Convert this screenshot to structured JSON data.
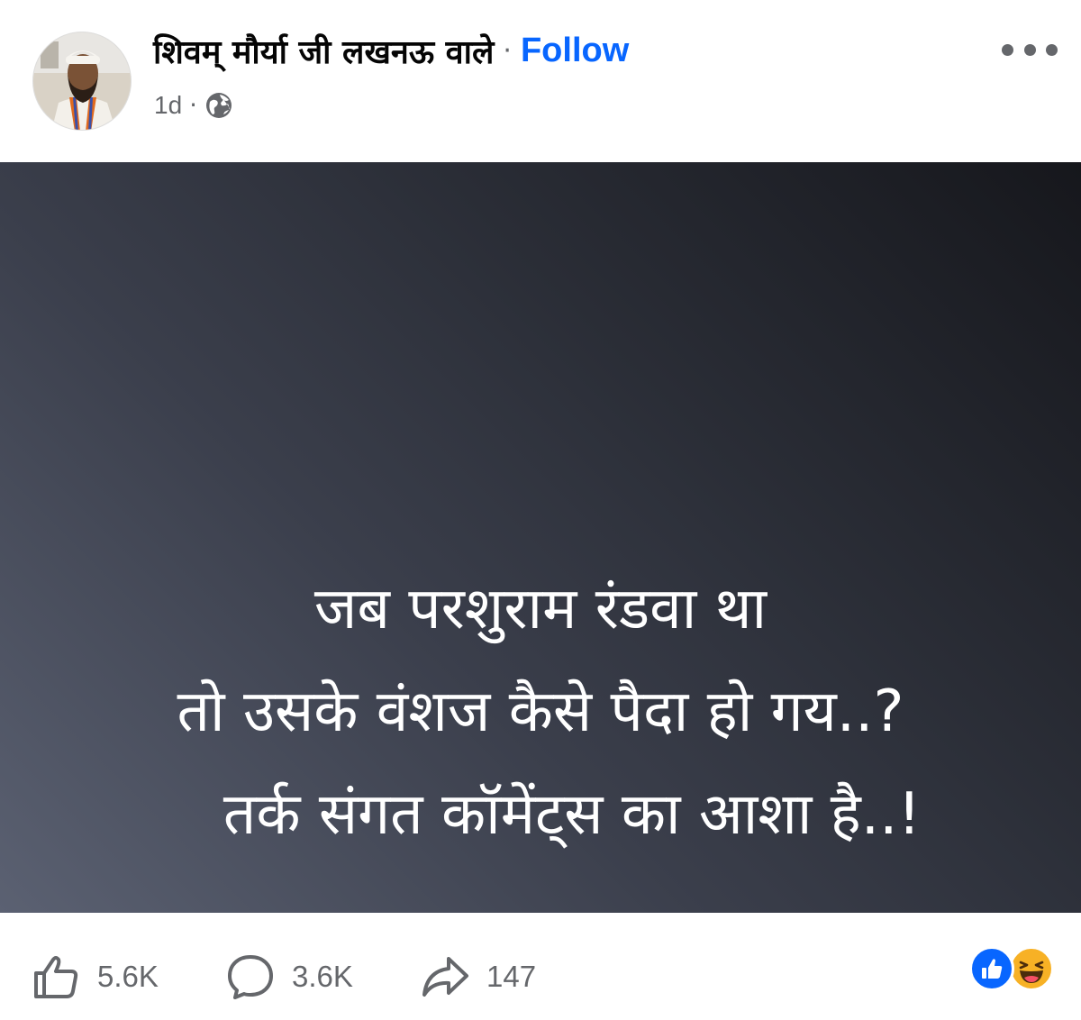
{
  "post": {
    "author": "शिवम् मौर्या जी लखनऊ वाले",
    "separator": "·",
    "follow_label": "Follow",
    "time": "1d",
    "meta_separator": "·",
    "privacy_icon": "globe-icon",
    "more_icon": "more-options-icon",
    "image_text": [
      "जब परशुराम रंडवा था",
      "तो उसके वंशज कैसे पैदा हो गय..?",
      "तर्क संगत कॉमेंट्स का आशा है..!"
    ]
  },
  "footer": {
    "like_count": "5.6K",
    "comment_count": "3.6K",
    "share_count": "147",
    "reactions": [
      "like-reaction-icon",
      "haha-reaction-icon"
    ]
  },
  "colors": {
    "accent": "#0866ff",
    "secondary_text": "#65676b",
    "image_gradient_start": "#5b6172",
    "image_gradient_end": "#16171c"
  }
}
